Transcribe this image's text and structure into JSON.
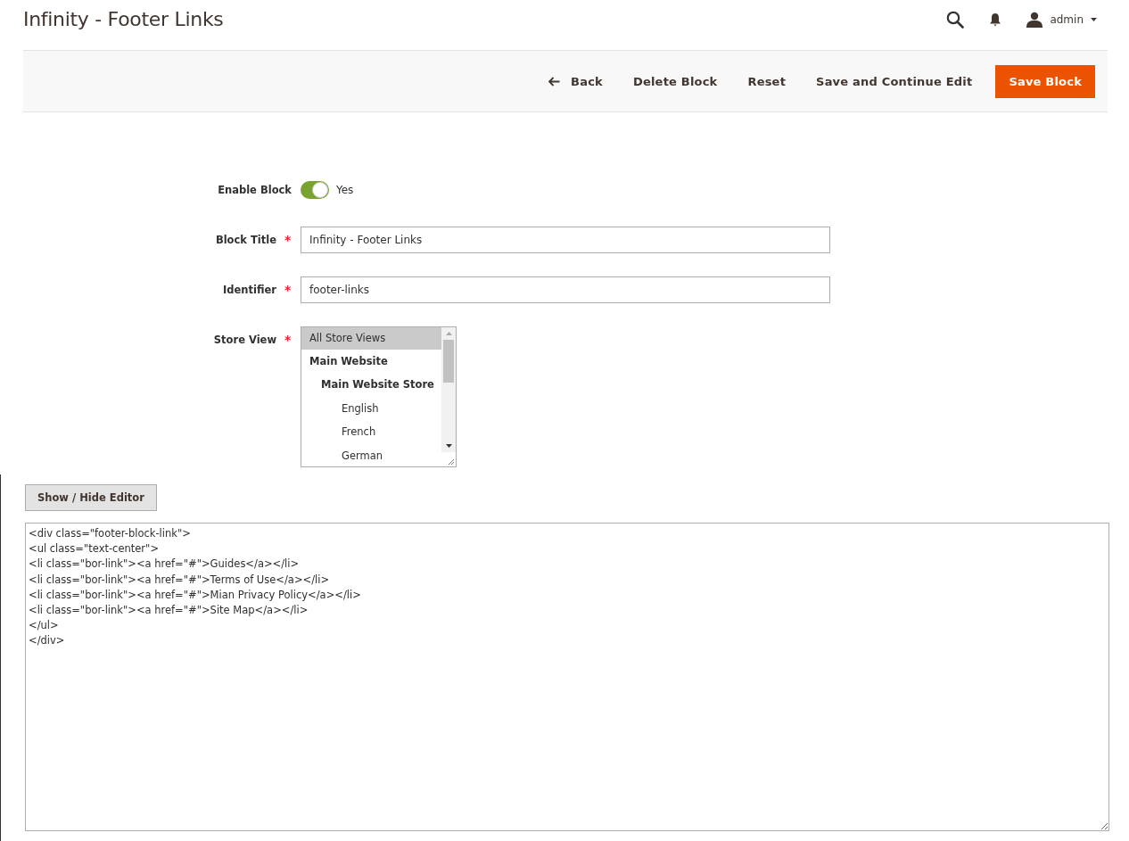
{
  "page_title": "Infinity - Footer Links",
  "header": {
    "user": "admin"
  },
  "toolbar": {
    "back": "Back",
    "buttons": [
      {
        "label": "Delete Block",
        "kind": "secondary"
      },
      {
        "label": "Reset",
        "kind": "secondary"
      },
      {
        "label": "Save and Continue Edit",
        "kind": "secondary"
      },
      {
        "label": "Save Block",
        "kind": "primary"
      }
    ]
  },
  "enable_block": {
    "label": "Enable Block",
    "on": true,
    "value": "Yes"
  },
  "fields": [
    {
      "label": "Block Title",
      "required_mark": "*",
      "value": "Infinity - Footer Links"
    },
    {
      "label": "Identifier",
      "required_mark": "*",
      "value": "footer-links"
    }
  ],
  "store_view": {
    "label": "Store View",
    "required_mark": "*",
    "options": [
      {
        "label": "All Store Views",
        "selected": true
      },
      {
        "label": "Main Website",
        "selected": false,
        "children": [
          {
            "label": "Main Website Store",
            "selected": false,
            "children": [
              {
                "label": "English",
                "selected": false
              },
              {
                "label": "French",
                "selected": false
              },
              {
                "label": "German",
                "selected": false
              }
            ]
          }
        ]
      }
    ]
  },
  "editor": {
    "toggle": "Show / Hide Editor",
    "lines": [
      "<div class=\"footer-block-link\">",
      "<ul class=\"text-center\">",
      "<li class=\"bor-link\"><a href=\"#\">Guides</a></li>",
      "<li class=\"bor-link\"><a href=\"#\">Terms of Use</a></li>",
      "<li class=\"bor-link\"><a href=\"#\">Mian Privacy Policy</a></li>",
      "<li class=\"bor-link\"><a href=\"#\">Site Map</a></li>",
      "</ul>",
      "</div>"
    ]
  }
}
